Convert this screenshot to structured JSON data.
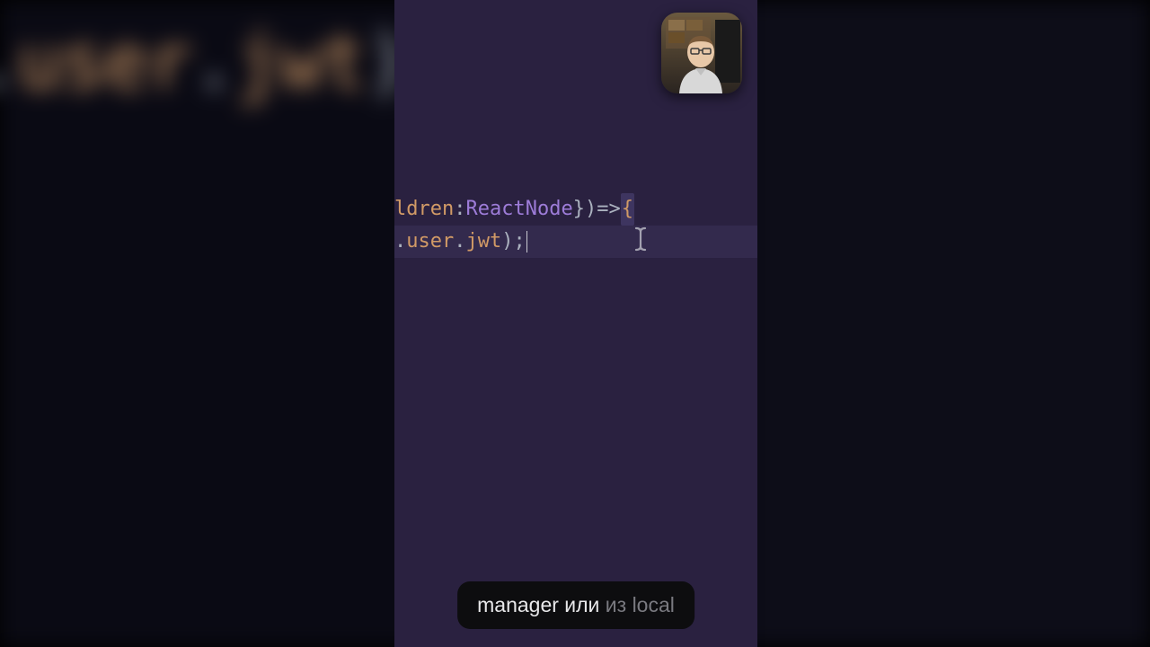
{
  "background": {
    "blurred_text_prop": "user",
    "blurred_text_punct1": ".",
    "blurred_text_prop2": "jwt",
    "blurred_text_punct2": ")"
  },
  "code": {
    "line1": {
      "t1": "ldren",
      "t2": ": ",
      "t3": "ReactNode",
      "t4": " }) ",
      "t5": "=>",
      "t6": " ",
      "t7": "{"
    },
    "line2": {
      "t1": ".",
      "t2": "user",
      "t3": ".",
      "t4": "jwt",
      "t5": ");"
    }
  },
  "caption": {
    "main": "manager или ",
    "dim": "из local"
  },
  "icons": {
    "text_cursor": "text-cursor-icon",
    "webcam": "webcam-overlay"
  }
}
